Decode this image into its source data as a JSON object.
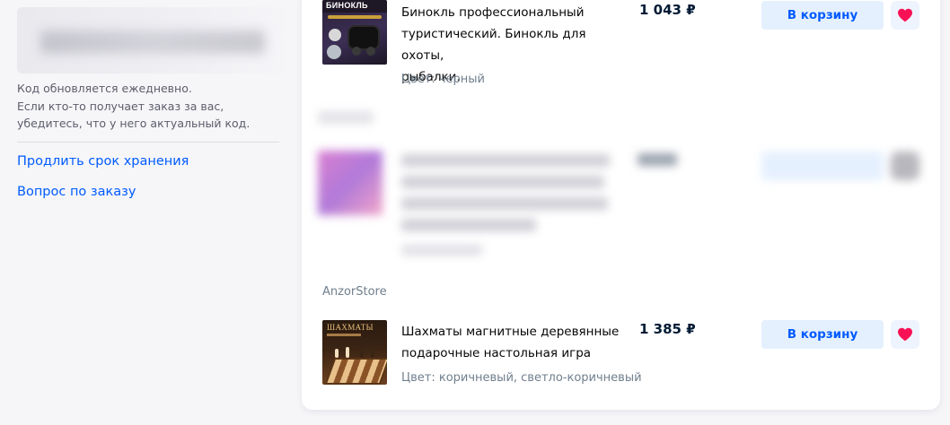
{
  "left": {
    "note_lines": [
      "Код обновляется ежедневно.",
      "Если кто-то получает заказ за вас,",
      "убедитесь, что у него актуальный код."
    ],
    "links": [
      "Продлить срок хранения",
      "Вопрос по заказу"
    ]
  },
  "items": [
    {
      "title_lines": [
        "Бинокль профессиональный",
        "туристический. Бинокль для охоты,",
        "рыбалки."
      ],
      "color": "Цвет: черный",
      "price": "1 043 ₽",
      "thumb_text": "БИНОКЛЬ",
      "cart_label": "В корзину",
      "fav_icon": "heart-icon",
      "fav_color": "#f91155"
    },
    {
      "seller": "AnzorStore",
      "title_lines": [
        "Шахматы магнитные деревянные",
        "подарочные настольная игра"
      ],
      "color": "Цвет: коричневый, светло-коричневый",
      "price": "1 385 ₽",
      "thumb_text": "ШАХМАТЫ",
      "cart_label": "В корзину",
      "fav_icon": "heart-icon",
      "fav_color": "#f91155"
    }
  ],
  "colors": {
    "accent": "#005bff",
    "button_bg": "#e5f0fe",
    "favorite": "#f91155"
  }
}
